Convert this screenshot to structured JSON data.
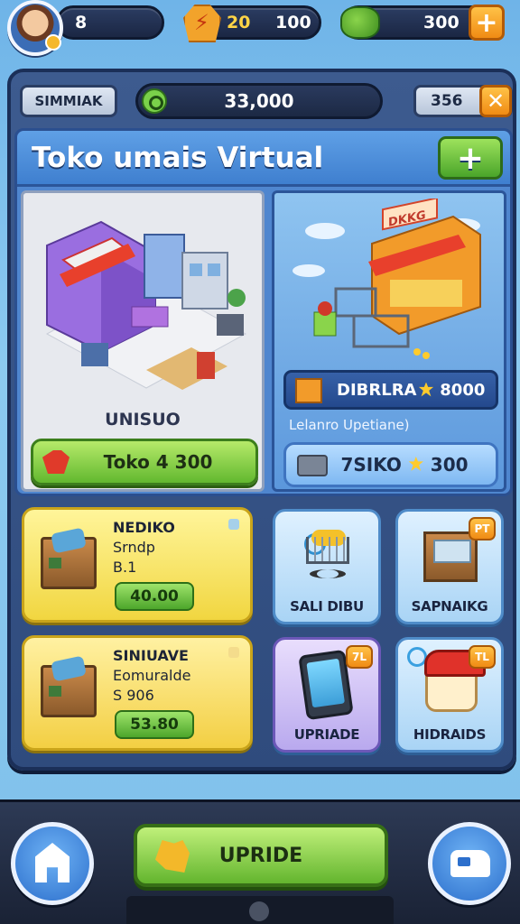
{
  "topbar": {
    "level": "8",
    "gems_a": "20",
    "gems_b": "100",
    "cash": "300",
    "add_label": "+"
  },
  "subbar": {
    "tag": "SIMMIAK",
    "progress": "33,000",
    "score": "356",
    "close_label": "✕"
  },
  "store": {
    "title": "Toko umais Virtual",
    "add_label": "+",
    "left": {
      "name": "UNISUO",
      "button_label": "Toko 4 300"
    },
    "right": {
      "sign": "DKKG",
      "price_name": "DIBRLRA",
      "price_value": "8000",
      "caption": "Lelanro Upetiane)",
      "button_label": "7SIKO",
      "button_value": "300"
    }
  },
  "items": [
    {
      "title": "NEDIKO",
      "line2": "Srndp",
      "line3": "B.1",
      "price": "40.00"
    },
    {
      "title": "SINIUAVE",
      "line2": "Eomuralde",
      "line3": "S 906",
      "price": "53.80"
    }
  ],
  "tiles": [
    {
      "label": "SALI DIBU",
      "corner": "",
      "icon": "shopping-cart-icon"
    },
    {
      "label": "SAPNAIKG",
      "corner": "PT",
      "icon": "crate-icon"
    },
    {
      "label": "UPRIADE",
      "corner": "7L",
      "icon": "phone-icon"
    },
    {
      "label": "HIDRAIDS",
      "corner": "TL",
      "icon": "chef-icon"
    }
  ],
  "bottom": {
    "upgrade_label": "UPRIDE"
  },
  "colors": {
    "accent_orange": "#f08b14",
    "accent_green": "#4aa52a",
    "panel_blue": "#2f4b7d"
  }
}
